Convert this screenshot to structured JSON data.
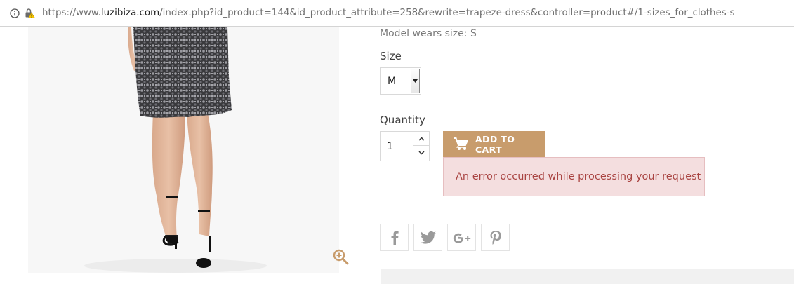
{
  "browser": {
    "url_prefix": "https://www.",
    "url_host": "luzibiza.com",
    "url_path": "/index.php?id_product=144&id_product_attribute=258&rewrite=trapeze-dress&controller=product#/1-sizes_for_clothes-s"
  },
  "product": {
    "model_wears": "Model wears size: S",
    "size_label": "Size",
    "size_selected": "M",
    "quantity_label": "Quantity",
    "quantity_value": "1",
    "add_to_cart_label": "ADD TO CART",
    "error_message": "An error occurred while processing your request"
  },
  "social": {
    "icons": [
      "facebook-icon",
      "twitter-icon",
      "google-plus-icon",
      "pinterest-icon"
    ]
  },
  "colors": {
    "accent": "#c89c6c",
    "error_bg": "#f4dedf",
    "error_text": "#a94442"
  }
}
